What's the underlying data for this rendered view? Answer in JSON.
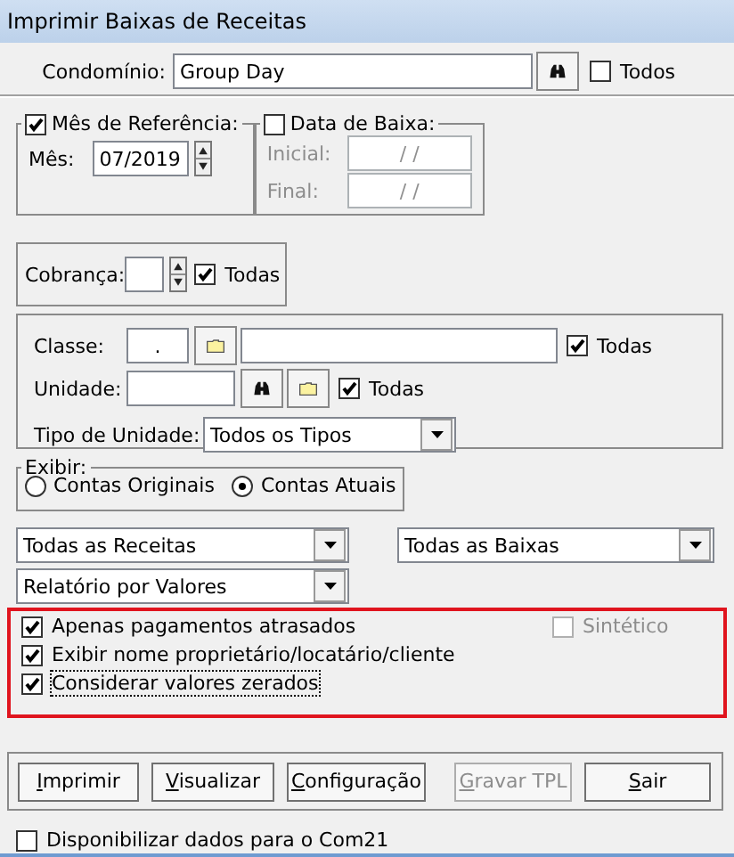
{
  "window": {
    "title": "Imprimir Baixas de Receitas"
  },
  "condominio": {
    "label": "Condomínio:",
    "value": "Group Day",
    "todos": {
      "label": "Todos",
      "checked": false
    }
  },
  "mes_referencia": {
    "label": "Mês de Referência:",
    "checked": true,
    "mes_label": "Mês:",
    "mes_value": "07/2019"
  },
  "data_baixa": {
    "label": "Data de Baixa:",
    "checked": false,
    "fields": [
      {
        "label": "Inicial:",
        "value": "/ /",
        "disabled": true
      },
      {
        "label": "Final:",
        "value": "/ /",
        "disabled": true
      }
    ]
  },
  "cobranca": {
    "label": "Cobrança:",
    "todas": {
      "label": "Todas",
      "checked": true
    }
  },
  "classe": {
    "label": "Classe:",
    "code": ".",
    "todas": {
      "label": "Todas",
      "checked": true
    }
  },
  "unidade": {
    "label": "Unidade:",
    "todas": {
      "label": "Todas",
      "checked": true
    }
  },
  "tipo_unidade": {
    "label": "Tipo de Unidade:",
    "value": "Todos os Tipos"
  },
  "exibir": {
    "label": "Exibir:",
    "options": [
      {
        "label": "Contas Originais",
        "selected": false
      },
      {
        "label": "Contas Atuais",
        "selected": true
      }
    ]
  },
  "dropdowns": [
    {
      "value": "Todas as Receitas"
    },
    {
      "value": "Todas as Baixas"
    },
    {
      "value": "Relatório por Valores"
    }
  ],
  "options": [
    {
      "label": "Apenas pagamentos atrasados",
      "checked": true,
      "focused": false
    },
    {
      "label": "Exibir nome proprietário/locatário/cliente",
      "checked": true,
      "focused": false
    },
    {
      "label": "Considerar valores zerados",
      "checked": true,
      "focused": true
    }
  ],
  "sintetico": {
    "label": "Sintético",
    "checked": false,
    "disabled": true
  },
  "buttons": [
    {
      "label": "Imprimir",
      "disabled": false
    },
    {
      "label": "Visualizar",
      "disabled": false
    },
    {
      "label": "Configuração",
      "disabled": false
    },
    {
      "label": "Gravar TPL",
      "disabled": true
    },
    {
      "label": "Sair",
      "disabled": false
    }
  ],
  "com21": {
    "label": "Disponibilizar dados para o Com21",
    "checked": false
  }
}
